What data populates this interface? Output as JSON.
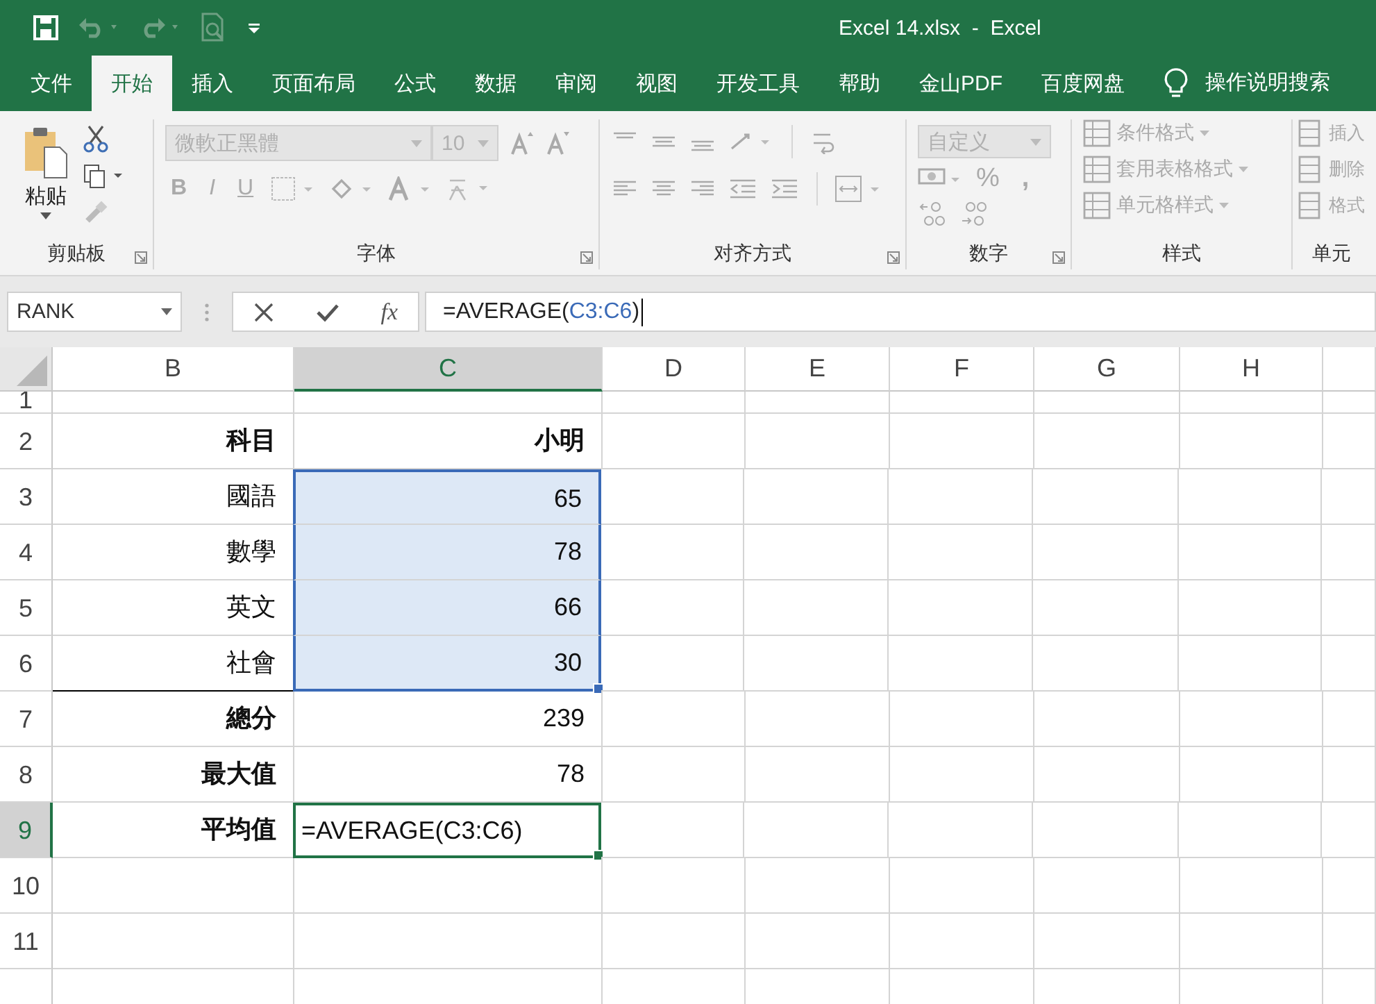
{
  "title_bar": {
    "title": "Excel 14.xlsx  -  Excel"
  },
  "ribbon_tabs": [
    {
      "label": "文件",
      "selected": false
    },
    {
      "label": "开始",
      "selected": true
    },
    {
      "label": "插入",
      "selected": false
    },
    {
      "label": "页面布局",
      "selected": false
    },
    {
      "label": "公式",
      "selected": false
    },
    {
      "label": "数据",
      "selected": false
    },
    {
      "label": "审阅",
      "selected": false
    },
    {
      "label": "视图",
      "selected": false
    },
    {
      "label": "开发工具",
      "selected": false
    },
    {
      "label": "帮助",
      "selected": false
    },
    {
      "label": "金山PDF",
      "selected": false
    },
    {
      "label": "百度网盘",
      "selected": false
    }
  ],
  "tell_me": "操作说明搜索",
  "ribbon": {
    "clipboard": {
      "label": "剪贴板",
      "paste": "粘贴"
    },
    "font": {
      "label": "字体",
      "font_name": "微軟正黑體",
      "font_size": "10",
      "bold": "B",
      "italic": "I",
      "underline": "U"
    },
    "alignment": {
      "label": "对齐方式"
    },
    "number": {
      "label": "数字",
      "format": "自定义",
      "percent": "%",
      "comma": ","
    },
    "styles": {
      "label": "样式",
      "items": [
        "条件格式",
        "套用表格格式",
        "单元格样式"
      ]
    },
    "cells": {
      "label": "单元",
      "items": [
        "插入",
        "删除",
        "格式"
      ]
    }
  },
  "formula_bar": {
    "name_box": "RANK",
    "fx": "fx",
    "formula": [
      {
        "text": "=AVERAGE(",
        "kind": "plain"
      },
      {
        "text": "C3:C6",
        "kind": "ref"
      },
      {
        "text": ")",
        "kind": "plain"
      }
    ]
  },
  "sheet": {
    "columns": [
      {
        "label": "B",
        "selected": false
      },
      {
        "label": "C",
        "selected": true
      },
      {
        "label": "D",
        "selected": false
      },
      {
        "label": "E",
        "selected": false
      },
      {
        "label": "F",
        "selected": false
      },
      {
        "label": "G",
        "selected": false
      },
      {
        "label": "H",
        "selected": false
      }
    ],
    "rows": [
      {
        "label": "1",
        "selected": false,
        "in_selection": false,
        "editing": false
      },
      {
        "label": "2",
        "selected": false,
        "in_selection": false,
        "editing": false,
        "cells": [
          {
            "text": "科目",
            "bold": true,
            "border_bottom": false
          },
          {
            "text": "小明",
            "bold": true,
            "border_bottom": false
          }
        ]
      },
      {
        "label": "3",
        "selected": false,
        "in_selection": true,
        "editing": false,
        "cells": [
          {
            "text": "國語",
            "bold": false,
            "border_bottom": false
          },
          {
            "text": "65",
            "bold": false,
            "border_bottom": false
          }
        ]
      },
      {
        "label": "4",
        "selected": false,
        "in_selection": true,
        "editing": false,
        "cells": [
          {
            "text": "數學",
            "bold": false,
            "border_bottom": false
          },
          {
            "text": "78",
            "bold": false,
            "border_bottom": false
          }
        ]
      },
      {
        "label": "5",
        "selected": false,
        "in_selection": true,
        "editing": false,
        "cells": [
          {
            "text": "英文",
            "bold": false,
            "border_bottom": false
          },
          {
            "text": "66",
            "bold": false,
            "border_bottom": false
          }
        ]
      },
      {
        "label": "6",
        "selected": false,
        "in_selection": true,
        "editing": false,
        "cells": [
          {
            "text": "社會",
            "bold": false,
            "border_bottom": true
          },
          {
            "text": "30",
            "bold": false,
            "border_bottom": false
          }
        ]
      },
      {
        "label": "7",
        "selected": false,
        "in_selection": false,
        "editing": false,
        "cells": [
          {
            "text": "總分",
            "bold": true,
            "border_bottom": false
          },
          {
            "text": "239",
            "bold": false,
            "border_bottom": false
          }
        ]
      },
      {
        "label": "8",
        "selected": false,
        "in_selection": false,
        "editing": false,
        "cells": [
          {
            "text": "最大值",
            "bold": true,
            "border_bottom": false
          },
          {
            "text": "78",
            "bold": false,
            "border_bottom": false
          }
        ]
      },
      {
        "label": "9",
        "selected": true,
        "in_selection": false,
        "editing": true,
        "cells": [
          {
            "text": "平均值",
            "bold": true,
            "border_bottom": false
          },
          {
            "text": "=AVERAGE(C3:C6)",
            "bold": false,
            "border_bottom": false
          }
        ]
      },
      {
        "label": "10",
        "selected": false,
        "in_selection": false,
        "editing": false
      },
      {
        "label": "11",
        "selected": false,
        "in_selection": false,
        "editing": false
      }
    ]
  }
}
